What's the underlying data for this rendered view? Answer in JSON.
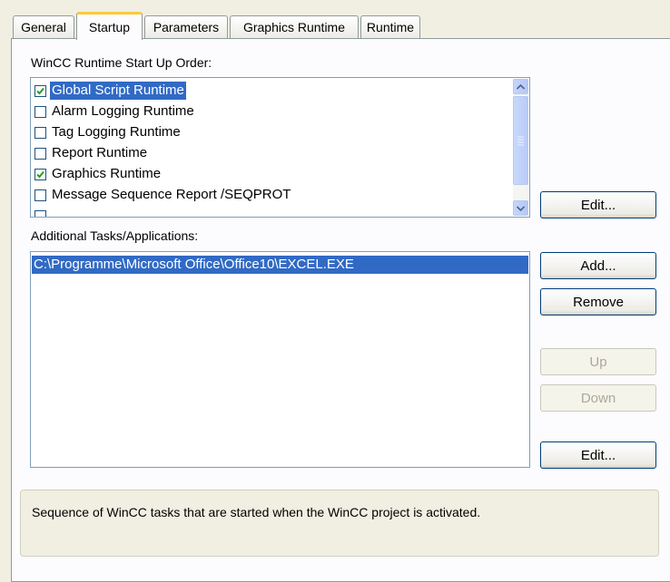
{
  "tabs": [
    {
      "label": "General",
      "active": false
    },
    {
      "label": "Startup",
      "active": true
    },
    {
      "label": "Parameters",
      "active": false
    },
    {
      "label": "Graphics Runtime",
      "active": false
    },
    {
      "label": "Runtime",
      "active": false
    }
  ],
  "startup_order": {
    "label": "WinCC Runtime Start Up Order:",
    "items": [
      {
        "label": "Global Script Runtime",
        "checked": true,
        "selected": true
      },
      {
        "label": "Alarm Logging Runtime",
        "checked": false,
        "selected": false
      },
      {
        "label": "Tag Logging Runtime",
        "checked": false,
        "selected": false
      },
      {
        "label": "Report Runtime",
        "checked": false,
        "selected": false
      },
      {
        "label": "Graphics Runtime",
        "checked": true,
        "selected": false
      },
      {
        "label": "Message Sequence Report /SEQPROT",
        "checked": false,
        "selected": false
      }
    ],
    "edit_label": "Edit..."
  },
  "additional": {
    "label": "Additional Tasks/Applications:",
    "items": [
      {
        "label": "C:\\Programme\\Microsoft Office\\Office10\\EXCEL.EXE",
        "selected": true
      }
    ],
    "add_label": "Add...",
    "remove_label": "Remove",
    "up_label": "Up",
    "down_label": "Down",
    "edit_label": "Edit..."
  },
  "description": "Sequence of WinCC tasks that are started when the WinCC project is activated.",
  "colors": {
    "selection": "#316ac5",
    "active_tab_accent": "#ffc83c",
    "dialog_bg": "#f1efe2"
  }
}
